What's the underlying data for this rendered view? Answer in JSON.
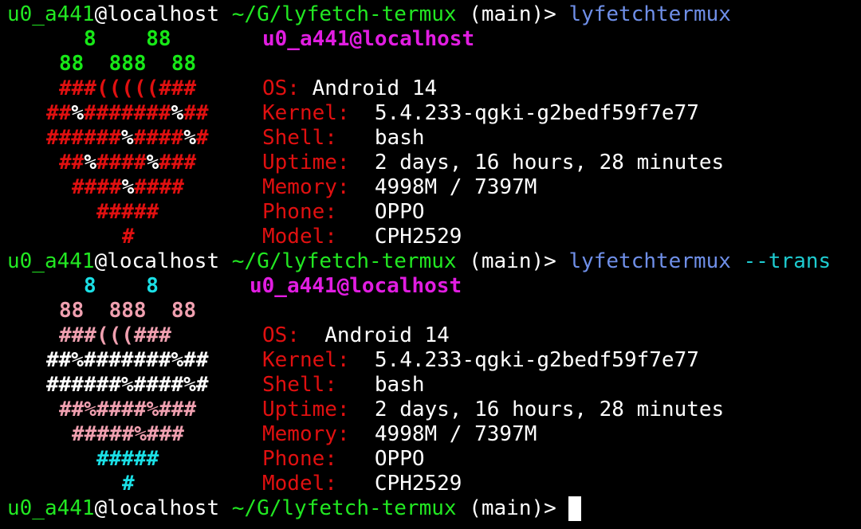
{
  "colors": {
    "background": "#000000",
    "user": "#22e822",
    "path": "#22e822",
    "command": "#6f8fe8",
    "flag": "#1ecbd0",
    "header": "#e11de1",
    "label": "#e01010",
    "value": "#ffffff",
    "art_green": "#17e817",
    "art_red": "#e01010",
    "art_white": "#ffffff",
    "art_cyan": "#1be0e6",
    "art_pink": "#f0a0b0"
  },
  "prompt": {
    "user": "u0_a441",
    "at": "@",
    "host": "localhost",
    "path": "~/G/lyfetch-termux",
    "branch": "(main)>"
  },
  "commands": {
    "first": "lyfetchtermux",
    "second": "lyfetchtermux",
    "second_flag": "--trans"
  },
  "fetch1": {
    "header": "u0_a441@localhost",
    "art": [
      "8    88",
      "88  888  88",
      "###(((((###",
      "##%#######%##",
      "######%####%#",
      "##%####%###",
      "####%####",
      "#####",
      "#"
    ],
    "info": [
      {
        "label": "OS:",
        "value": "Android 14"
      },
      {
        "label": "Kernel:",
        "value": "5.4.233-qgki-g2bedf59f7e77"
      },
      {
        "label": "Shell:",
        "value": "bash"
      },
      {
        "label": "Uptime:",
        "value": "2 days, 16 hours, 28 minutes"
      },
      {
        "label": "Memory:",
        "value": "4998M / 7397M"
      },
      {
        "label": "Phone:",
        "value": "OPPO"
      },
      {
        "label": "Model:",
        "value": "CPH2529"
      }
    ]
  },
  "fetch2": {
    "header": "u0_a441@localhost",
    "art": [
      "8    8",
      "88  888  88",
      "###(((###",
      "##%#######%##",
      "######%####%#",
      "##%####%###",
      "#####%###",
      "#####",
      "#"
    ],
    "info": [
      {
        "label": "OS:",
        "value": "Android 14"
      },
      {
        "label": "Kernel:",
        "value": "5.4.233-qgki-g2bedf59f7e77"
      },
      {
        "label": "Shell:",
        "value": "bash"
      },
      {
        "label": "Uptime:",
        "value": "2 days, 16 hours, 28 minutes"
      },
      {
        "label": "Memory:",
        "value": "4998M / 7397M"
      },
      {
        "label": "Phone:",
        "value": "OPPO"
      },
      {
        "label": "Model:",
        "value": "CPH2529"
      }
    ]
  }
}
